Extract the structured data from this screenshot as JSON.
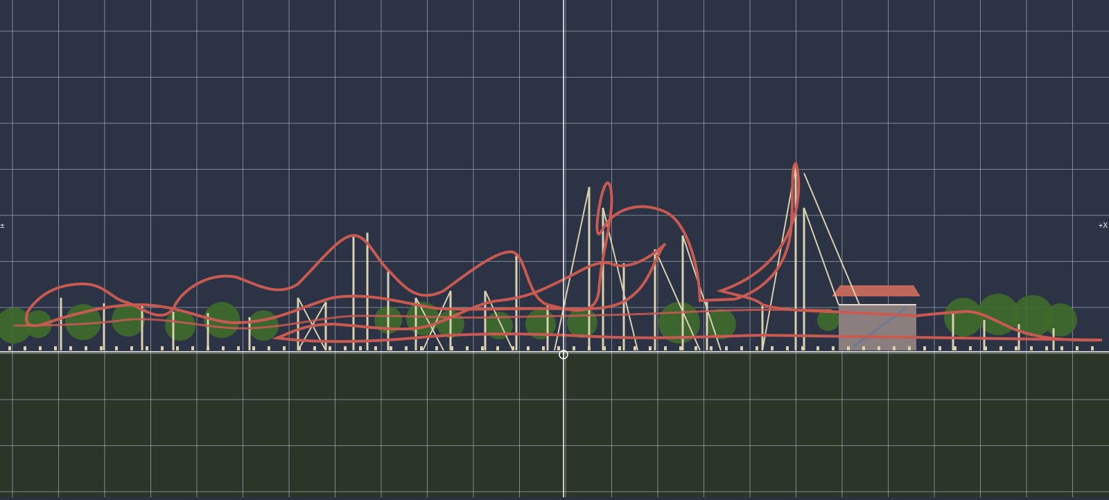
{
  "scene": {
    "sky_color": "#2c3344",
    "ground_color": "#2b3629",
    "grid_color": "#c9cdd4",
    "track_color": "#c95a52",
    "support_color": "#d8d0b0",
    "tree_color": "#3f6a2c",
    "station_roof_color": "#c0675c",
    "station_wall_color": "#8a7f7e"
  },
  "markers": {
    "left": "±",
    "right": "+X"
  },
  "icons": {
    "origin": "origin-crosshair-icon"
  }
}
